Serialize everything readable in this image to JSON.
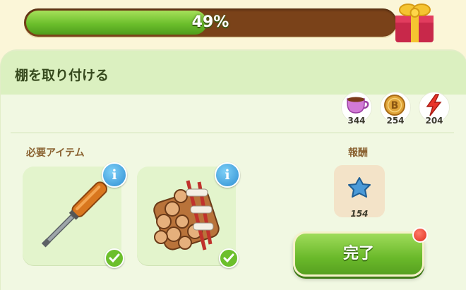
{
  "progress": {
    "label": "49%",
    "fraction": 0.49
  },
  "panel": {
    "title": "棚を取り付ける"
  },
  "resources": [
    {
      "icon": "tea-cup-icon",
      "value": "344"
    },
    {
      "icon": "coin-icon",
      "value": "254"
    },
    {
      "icon": "energy-bolt-icon",
      "value": "204"
    }
  ],
  "required": {
    "label": "必要アイテム",
    "items": [
      {
        "icon": "screwdriver-icon",
        "info": "i"
      },
      {
        "icon": "firewood-bundle-icon",
        "info": "i"
      }
    ]
  },
  "reward": {
    "label": "報酬",
    "icon": "blue-star-icon",
    "value": "154"
  },
  "complete_button": {
    "label": "完了"
  },
  "colors": {
    "accent_green": "#6cbf2c",
    "bar_brown": "#7a4219",
    "info_blue": "#2f8ed3",
    "notif_red": "#e0301e"
  }
}
